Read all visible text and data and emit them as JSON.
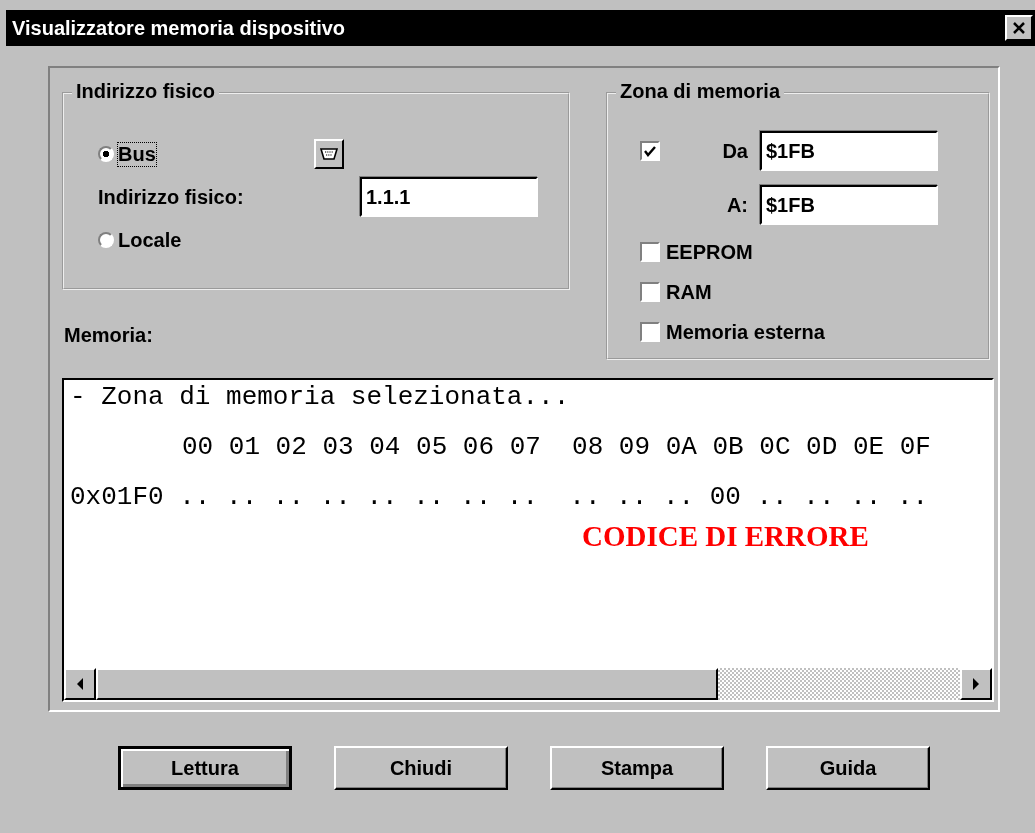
{
  "window": {
    "title": "Visualizzatore memoria dispositivo"
  },
  "physical_address": {
    "title": "Indirizzo fisico",
    "modes": [
      {
        "label": "Bus",
        "selected": true
      },
      {
        "label": "Locale",
        "selected": false
      }
    ],
    "address_label": "Indirizzo fisico:",
    "address_value": "1.1.1"
  },
  "memory_zone": {
    "title": "Zona di memoria",
    "range_enabled": true,
    "from_label": "Da",
    "from_value": "$1FB",
    "to_label": "A:",
    "to_value": "$1FB",
    "options": [
      {
        "label": "EEPROM",
        "checked": false
      },
      {
        "label": "RAM",
        "checked": false
      },
      {
        "label": "Memoria esterna",
        "checked": false
      }
    ]
  },
  "memory": {
    "label": "Memoria:",
    "lines": [
      {
        "kind": "note",
        "text": "- Zona di memoria selezionata..."
      },
      {
        "kind": "header",
        "text": "00 01 02 03 04 05 06 07  08 09 0A 0B 0C 0D 0E 0F"
      },
      {
        "kind": "row",
        "text": "0x01F0 .. .. .. .. .. .. .. ..  .. .. .. 00 .. .. .. .."
      }
    ],
    "annotation": "CODICE DI ERRORE"
  },
  "buttons": [
    {
      "label": "Lettura",
      "selected": true
    },
    {
      "label": "Chiudi",
      "selected": false
    },
    {
      "label": "Stampa",
      "selected": false
    },
    {
      "label": "Guida",
      "selected": false
    }
  ]
}
